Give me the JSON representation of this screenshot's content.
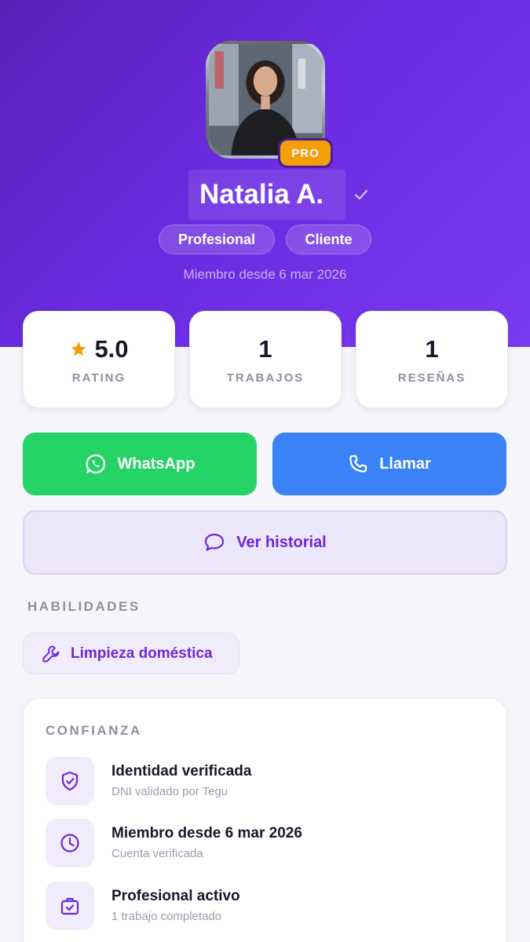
{
  "profile": {
    "name": "Natalia A.",
    "badge": "PRO",
    "roles": [
      "Profesional",
      "Cliente"
    ],
    "member_since": "Miembro desde 6 mar 2026"
  },
  "stats": [
    {
      "value": "5.0",
      "label": "RATING",
      "icon": "star-icon"
    },
    {
      "value": "1",
      "label": "TRABAJOS"
    },
    {
      "value": "1",
      "label": "RESEÑAS"
    }
  ],
  "actions": {
    "whatsapp_label": "WhatsApp",
    "call_label": "Llamar",
    "history_label": "Ver historial"
  },
  "skills": {
    "title": "HABILIDADES",
    "items": [
      "Limpieza doméstica"
    ]
  },
  "trust": {
    "title": "CONFIANZA",
    "items": [
      {
        "title": "Identidad verificada",
        "subtitle": "DNI validado por Tegu",
        "icon": "shield-check-icon"
      },
      {
        "title": "Miembro desde 6 mar 2026",
        "subtitle": "Cuenta verificada",
        "icon": "clock-icon"
      },
      {
        "title": "Profesional activo",
        "subtitle": "1 trabajo completado",
        "icon": "briefcase-check-icon"
      }
    ]
  },
  "colors": {
    "hero": "#6a2be0",
    "accent": "#6d28d9",
    "whatsapp": "#25d366",
    "call": "#3b82f6",
    "pro_badge": "#f59e0b",
    "star": "#f59e0b"
  }
}
